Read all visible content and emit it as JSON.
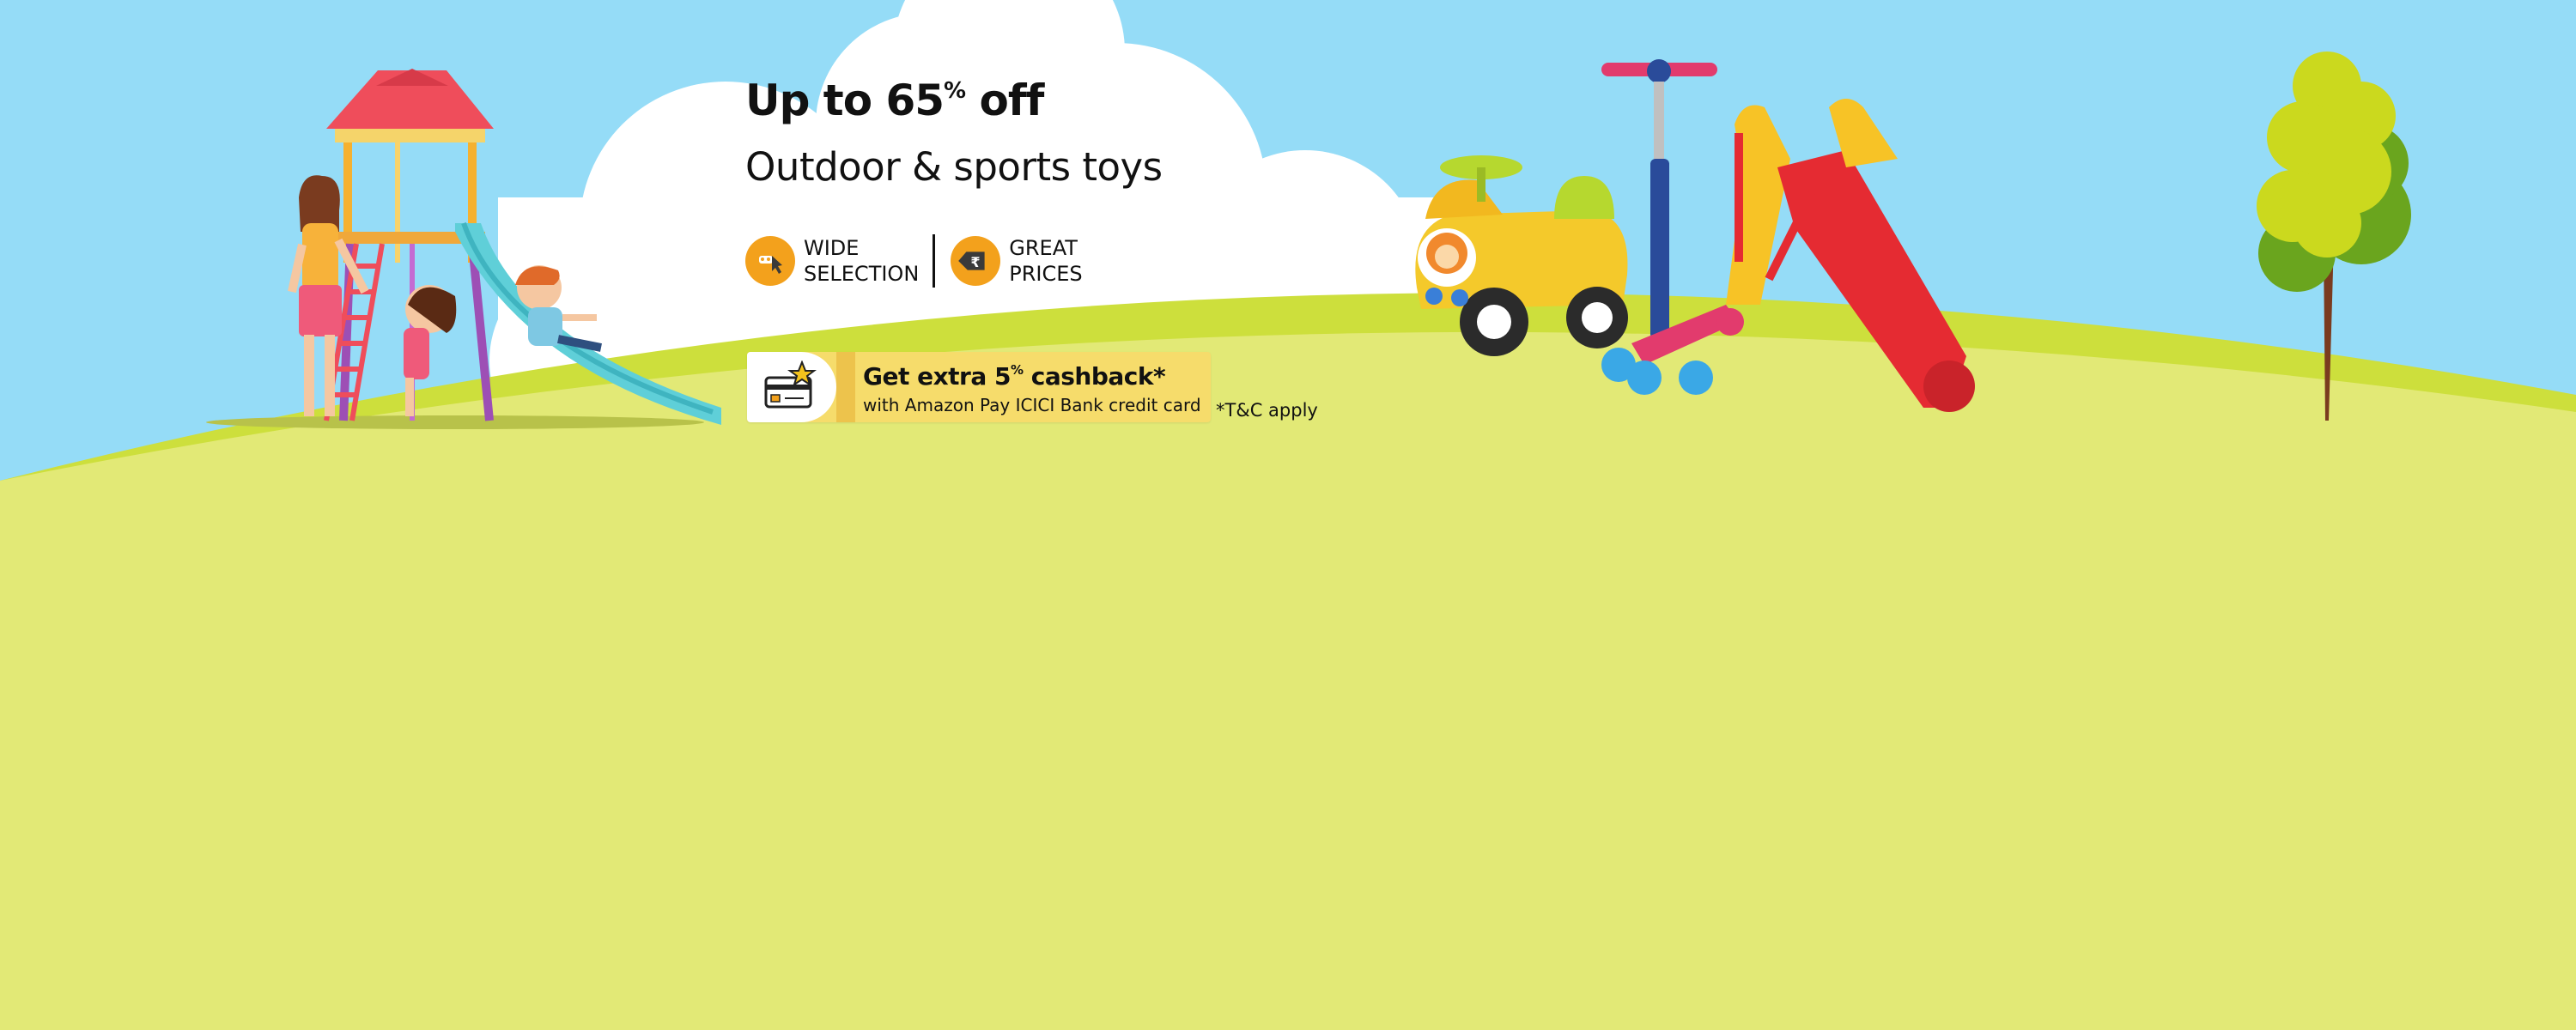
{
  "headline": {
    "prefix": "Up to 65",
    "percent_sign": "%",
    "suffix": " off"
  },
  "subheadline": "Outdoor & sports toys",
  "features": [
    {
      "icon": "pointer-hand-icon",
      "line1": "WIDE",
      "line2": "SELECTION"
    },
    {
      "icon": "rupee-price-tag-icon",
      "line1": "GREAT",
      "line2": "PRICES"
    }
  ],
  "offer": {
    "icon": "credit-card-star-icon",
    "title_prefix": "Get extra 5",
    "title_percent_sign": "%",
    "title_suffix": " cashback*",
    "subtitle": "with Amazon Pay ICICI Bank credit card"
  },
  "tnc": "*T&C apply",
  "colors": {
    "sky": "#95dcf7",
    "grass": "#e2e976",
    "grass_highlight": "#cddf3c",
    "cloud": "#ffffff",
    "feature_icon_bg": "#f3a11c",
    "offer_card_bg": "#f6dc6b",
    "offer_accent": "#edc34c",
    "text": "#111111"
  }
}
